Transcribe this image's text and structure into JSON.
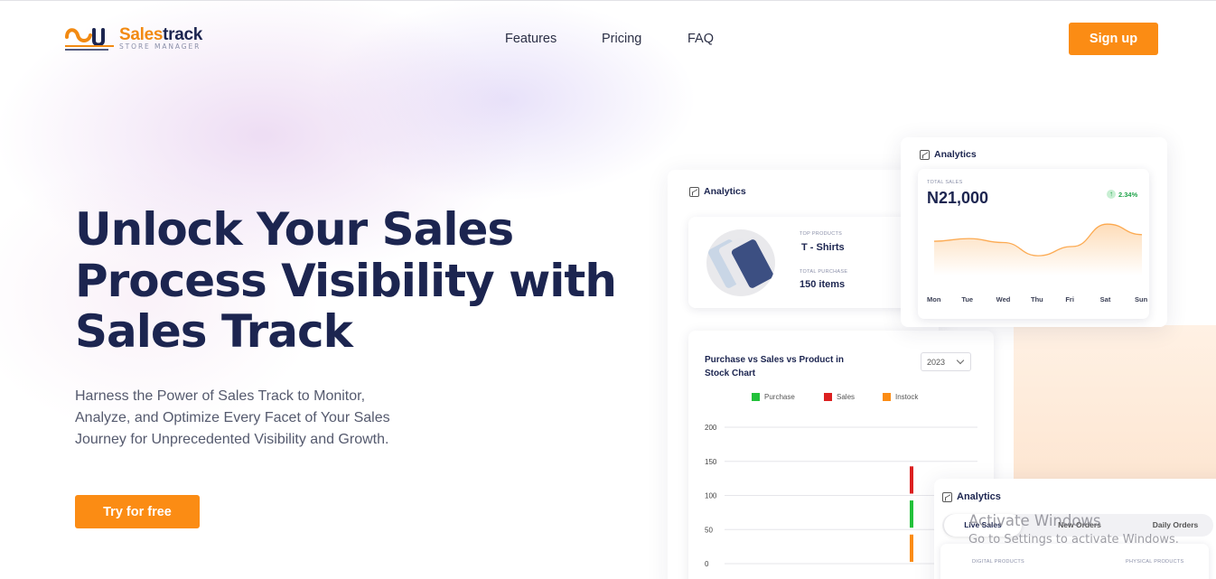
{
  "brand": {
    "name_part1": "Sales",
    "name_part2": "track",
    "tagline": "STORE MANAGER",
    "accent_color": "#fb8c14",
    "navy_color": "#1c2550"
  },
  "nav": {
    "links": [
      "Features",
      "Pricing",
      "FAQ"
    ],
    "signup_label": "Sign up"
  },
  "hero": {
    "title": "Unlock Your Sales Process Visibility with Sales Track",
    "description": "Harness the Power of Sales Track to Monitor, Analyze, and Optimize Every Facet of Your Sales Journey for Unprecedented Visibility and Growth.",
    "cta_label": "Try for free"
  },
  "main_card": {
    "title": "Analytics",
    "icon": "trend-chart-icon",
    "top_products_label": "TOP PRODUCTS",
    "top_products_value": "T - Shirts",
    "total_purchase_label": "TOTAL PURCHASE",
    "total_purchase_value": "150 items",
    "chart_title": "Purchase vs Sales vs Product in Stock Chart",
    "year": "2023"
  },
  "sales_card": {
    "title": "Analytics",
    "icon": "trend-chart-icon",
    "total_label": "TOTAL SALES",
    "total_value": "N21,000",
    "change": "2.34%",
    "days": [
      "Mon",
      "Tue",
      "Wed",
      "Thu",
      "Fri",
      "Sat",
      "Sun"
    ]
  },
  "bottom_card": {
    "title": "Analytics",
    "icon": "trend-chart-icon",
    "tabs": [
      "Live Sales",
      "New Orders",
      "Daily Orders"
    ],
    "digital_label": "DIGITAL PRODUCTS",
    "physical_label": "PHYSICAL PRODUCTS"
  },
  "chart_data": [
    {
      "type": "bar",
      "title": "Purchase vs Sales vs Product in Stock Chart",
      "legend_position": "top",
      "ylim": [
        0,
        200
      ],
      "yticks": [
        0,
        50,
        100,
        150,
        200
      ],
      "grid": true,
      "series": [
        {
          "name": "Purchase",
          "color": "#22c13a",
          "values": [
            40
          ]
        },
        {
          "name": "Sales",
          "color": "#dc2020",
          "values": [
            40
          ]
        },
        {
          "name": "Instock",
          "color": "#fb8c14",
          "values": [
            40
          ]
        }
      ]
    },
    {
      "type": "area",
      "x": [
        "Mon",
        "Tue",
        "Wed",
        "Thu",
        "Fri",
        "Sat",
        "Sun"
      ],
      "values": [
        52,
        56,
        50,
        30,
        44,
        78,
        62
      ],
      "ylim": [
        0,
        100
      ],
      "grid": false,
      "color": "#fb8c14"
    }
  ],
  "watermark": {
    "line1": "Activate Windows",
    "line2": "Go to Settings to activate Windows."
  }
}
